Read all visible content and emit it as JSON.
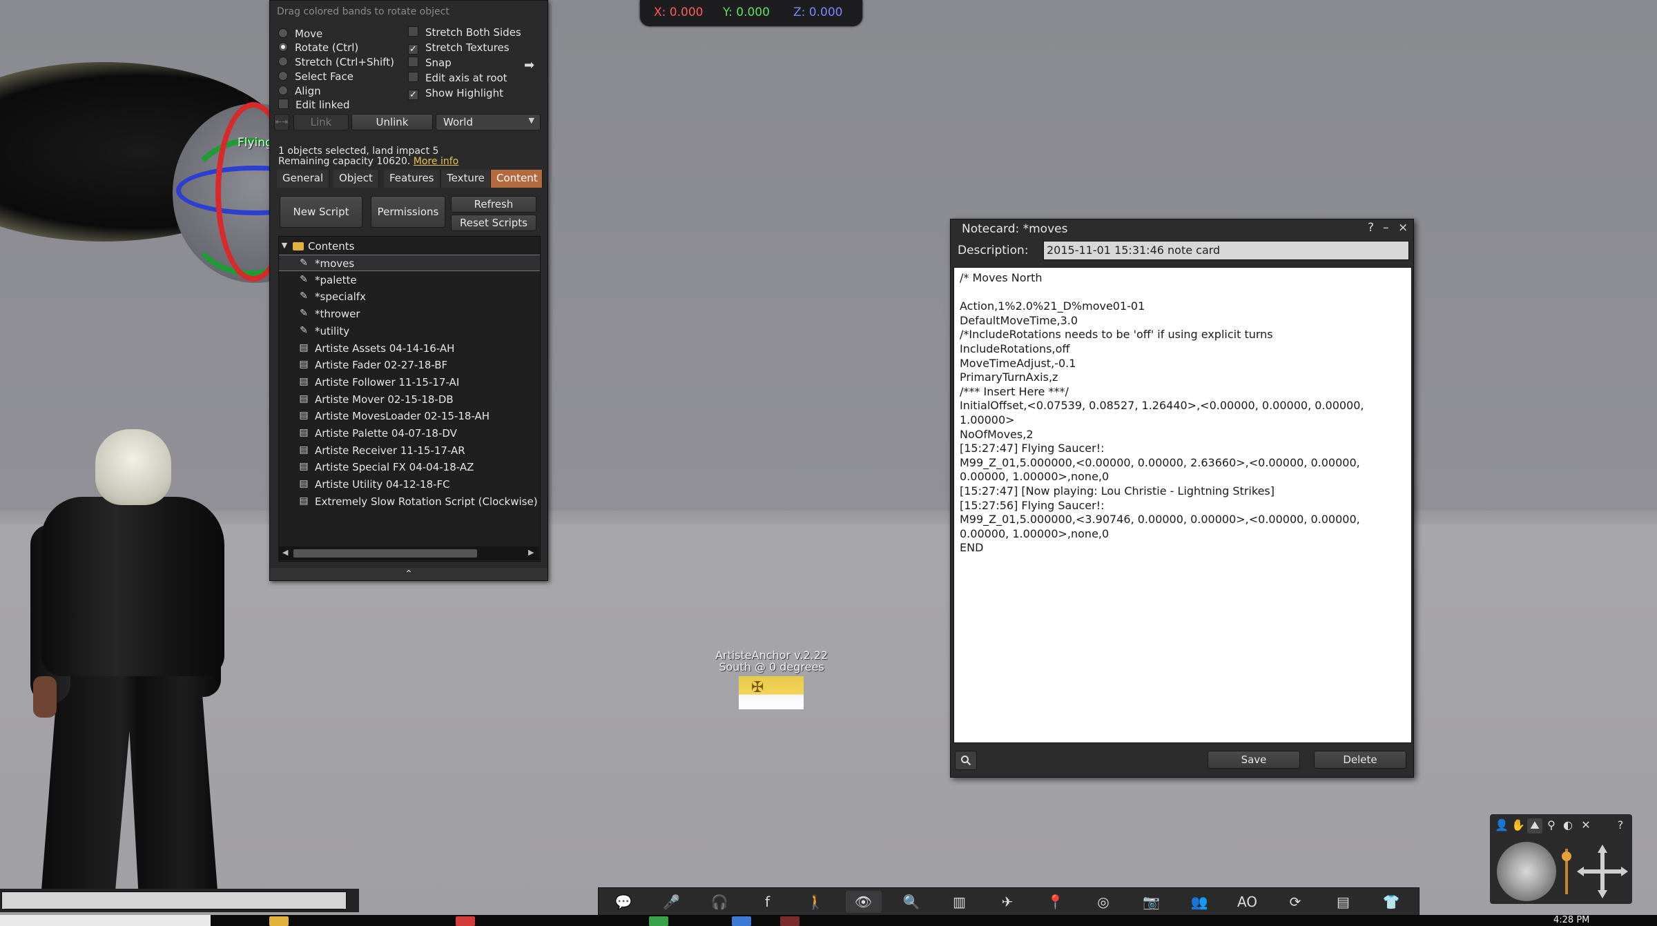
{
  "coords": {
    "x": "X: 0.000",
    "y": "Y: 0.000",
    "z": "Z: 0.000"
  },
  "world": {
    "flying_label": "Flying",
    "anchor_line1": "ArtisteAnchor v.2.22",
    "anchor_line2": "South @ 0 degrees"
  },
  "build": {
    "hint": "Drag colored bands to rotate object",
    "modes": [
      {
        "label": "Move",
        "selected": false
      },
      {
        "label": "Rotate (Ctrl)",
        "selected": true
      },
      {
        "label": "Stretch (Ctrl+Shift)",
        "selected": false
      },
      {
        "label": "Select Face",
        "selected": false
      },
      {
        "label": "Align",
        "selected": false
      }
    ],
    "edit_linked": "Edit linked",
    "options": [
      {
        "label": "Stretch Both Sides",
        "checked": false
      },
      {
        "label": "Stretch Textures",
        "checked": true
      },
      {
        "label": "Snap",
        "checked": false
      },
      {
        "label": "Edit axis at root",
        "checked": false
      },
      {
        "label": "Show Highlight",
        "checked": true
      }
    ],
    "link_label": "Link",
    "unlink_label": "Unlink",
    "ruler": "World",
    "selection_info": "1 objects selected, land impact 5",
    "capacity_info": "Remaining capacity 10620.",
    "more_info": "More info",
    "tabs": [
      {
        "label": "General",
        "active": false
      },
      {
        "label": "Object",
        "active": false
      },
      {
        "label": "Features",
        "active": false
      },
      {
        "label": "Texture",
        "active": false
      },
      {
        "label": "Content",
        "active": true
      }
    ],
    "new_script": "New Script",
    "permissions": "Permissions",
    "refresh": "Refresh",
    "reset_scripts": "Reset Scripts",
    "contents_folder": "Contents",
    "items": [
      {
        "name": "*moves",
        "kind": "notecard",
        "selected": true
      },
      {
        "name": "*palette",
        "kind": "notecard",
        "selected": false
      },
      {
        "name": "*specialfx",
        "kind": "notecard",
        "selected": false
      },
      {
        "name": "*thrower",
        "kind": "notecard",
        "selected": false
      },
      {
        "name": "*utility",
        "kind": "notecard",
        "selected": false
      },
      {
        "name": "Artiste Assets 04-14-16-AH",
        "kind": "script",
        "selected": false
      },
      {
        "name": "Artiste Fader 02-27-18-BF",
        "kind": "script",
        "selected": false
      },
      {
        "name": "Artiste Follower 11-15-17-AI",
        "kind": "script",
        "selected": false
      },
      {
        "name": "Artiste Mover 02-15-18-DB",
        "kind": "script",
        "selected": false
      },
      {
        "name": "Artiste MovesLoader 02-15-18-AH",
        "kind": "script",
        "selected": false
      },
      {
        "name": "Artiste Palette 04-07-18-DV",
        "kind": "script",
        "selected": false
      },
      {
        "name": "Artiste Receiver 11-15-17-AR",
        "kind": "script",
        "selected": false
      },
      {
        "name": "Artiste Special FX 04-04-18-AZ",
        "kind": "script",
        "selected": false
      },
      {
        "name": "Artiste Utility 04-12-18-FC",
        "kind": "script",
        "selected": false
      },
      {
        "name": "Extremely Slow Rotation Script (Clockwise) (",
        "kind": "script",
        "selected": false
      }
    ]
  },
  "notecard": {
    "title": "Notecard: *moves",
    "help": "?",
    "minimize": "–",
    "close": "×",
    "description_label": "Description:",
    "description": "2015-11-01 15:31:46 note card",
    "lines": [
      "/* Moves North",
      "",
      "Action,1%2.0%21_D%move01-01",
      "DefaultMoveTime,3.0",
      "/*IncludeRotations needs to be 'off' if using explicit turns",
      "IncludeRotations,off",
      "MoveTimeAdjust,-0.1",
      "PrimaryTurnAxis,z",
      "/*** Insert  Here ***/",
      "InitialOffset,<0.07539, 0.08527, 1.26440>,<0.00000, 0.00000, 0.00000,",
      "1.00000>",
      "NoOfMoves,2",
      "[15:27:47] Flying Saucer!:",
      "M99_Z_01,5.000000,<0.00000, 0.00000, 2.63660>,<0.00000, 0.00000,",
      "0.00000, 1.00000>,none,0",
      "[15:27:47] [Now playing: Lou Christie - Lightning Strikes]",
      "[15:27:56] Flying Saucer!:",
      "M99_Z_01,5.000000,<3.90746, 0.00000, 0.00000>,<0.00000, 0.00000,",
      "0.00000, 1.00000>,none,0",
      "END"
    ],
    "save": "Save",
    "delete": "Delete"
  },
  "toolbar": {
    "buttons": [
      {
        "name": "chat",
        "glyph": "💬"
      },
      {
        "name": "voice",
        "glyph": "🎤"
      },
      {
        "name": "speak",
        "glyph": "🎧"
      },
      {
        "name": "facebook",
        "glyph": "f"
      },
      {
        "name": "walk",
        "glyph": "🚶"
      },
      {
        "name": "view",
        "glyph": "👁"
      },
      {
        "name": "search",
        "glyph": "🔍"
      },
      {
        "name": "map",
        "glyph": "▥"
      },
      {
        "name": "teleport",
        "glyph": "✈"
      },
      {
        "name": "places",
        "glyph": "📍"
      },
      {
        "name": "radar",
        "glyph": "◎"
      },
      {
        "name": "snapshot",
        "glyph": "📷"
      },
      {
        "name": "people",
        "glyph": "👥"
      },
      {
        "name": "ao",
        "glyph": "AO"
      },
      {
        "name": "sync",
        "glyph": "⟳"
      },
      {
        "name": "inventory",
        "glyph": "▤"
      },
      {
        "name": "appearance",
        "glyph": "👕"
      }
    ]
  },
  "clock": "4:28 PM"
}
